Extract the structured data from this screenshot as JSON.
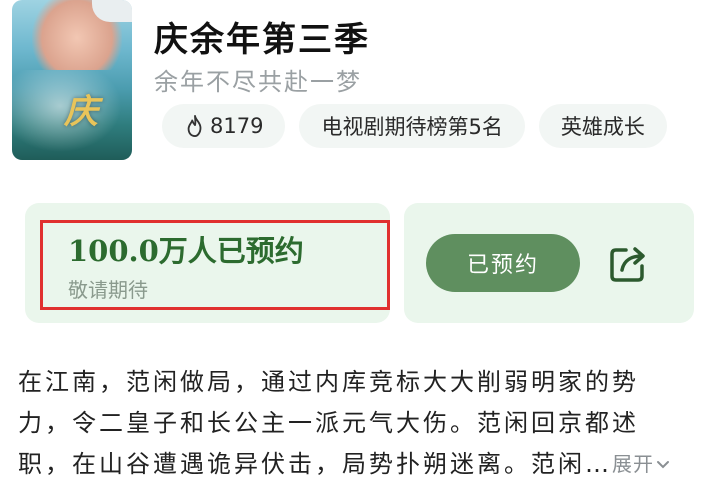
{
  "show": {
    "title": "庆余年第三季",
    "subtitle": "余年不尽共赴一梦",
    "poster_glyph": "庆"
  },
  "tags": [
    {
      "icon": "flame-icon",
      "label": "8179"
    },
    {
      "label": "电视剧期待榜第5名"
    },
    {
      "label": "英雄成长"
    }
  ],
  "reservation": {
    "count_label": "100.0万人已预约",
    "note": "敬请期待",
    "button_label": "已预约",
    "share_icon": "share-icon"
  },
  "description": {
    "line1": "在江南，范闲做局，通过内库竞标大大削弱明家的势",
    "line2": "力，令二皇子和长公主一派元气大伤。范闲回京都述",
    "line3": "职，在山谷遭遇诡异伏击，局势扑朔迷离。范闲…",
    "expand_label": "展开"
  },
  "colors": {
    "accent_green": "#5f8f5f",
    "panel_green": "#eaf6ec",
    "highlight_red": "#e0302f",
    "count_green": "#2c6b2f"
  }
}
